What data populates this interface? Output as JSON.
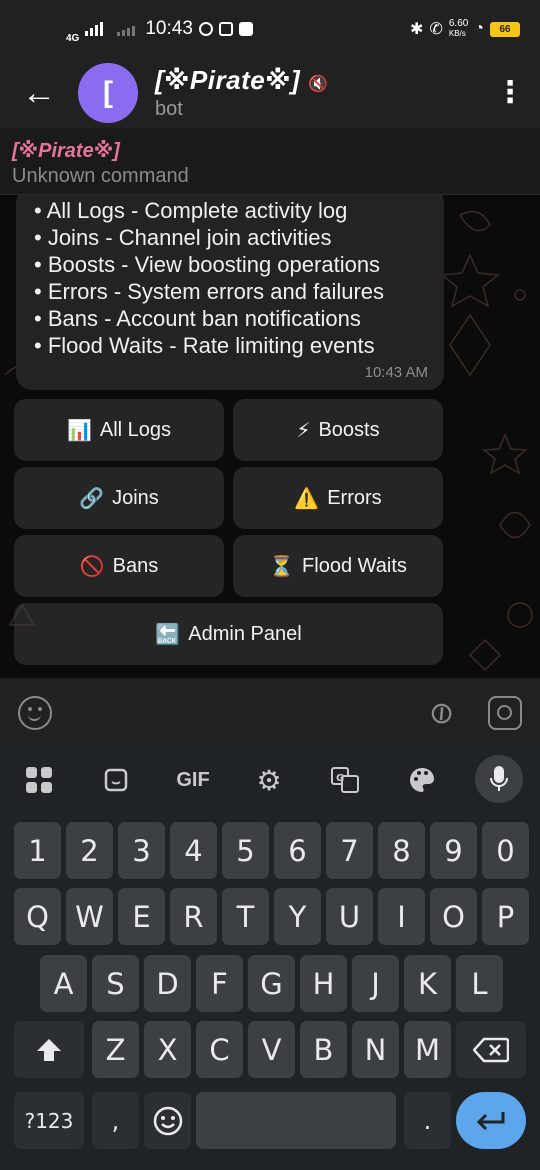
{
  "status_bar": {
    "network": "4G",
    "time": "10:43",
    "speed_value": "6.60",
    "speed_unit": "KB/s",
    "battery": "66"
  },
  "header": {
    "back_icon": "arrow-left-icon",
    "avatar_letter": "[",
    "avatar_color": "#8b6cf0",
    "title": "[※Pirate※]",
    "mute_icon": "🔇",
    "subtitle": "bot"
  },
  "pinned": {
    "sender": "[※Pirate※]",
    "message": "Unknown command",
    "sender_color": "#e8739a"
  },
  "message": {
    "lines": [
      "• All Logs - Complete activity log",
      "• Joins - Channel join activities",
      "• Boosts - View boosting operations",
      "• Errors - System errors and failures",
      "• Bans - Account ban notifications",
      "• Flood Waits - Rate limiting events"
    ],
    "time": "10:43 AM"
  },
  "inline_buttons": [
    {
      "icon": "📊",
      "label": "All Logs"
    },
    {
      "icon": "⚡",
      "label": "Boosts"
    },
    {
      "icon": "🔗",
      "label": "Joins"
    },
    {
      "icon": "⚠️",
      "label": "Errors"
    },
    {
      "icon": "🚫",
      "label": "Bans"
    },
    {
      "icon": "⏳",
      "label": "Flood Waits"
    },
    {
      "icon": "🔙",
      "label": "Admin Panel"
    }
  ],
  "keyboard": {
    "toolbar": {
      "gif": "GIF"
    },
    "row_numbers": [
      "1",
      "2",
      "3",
      "4",
      "5",
      "6",
      "7",
      "8",
      "9",
      "0"
    ],
    "row_1": [
      "Q",
      "W",
      "E",
      "R",
      "T",
      "Y",
      "U",
      "I",
      "O",
      "P"
    ],
    "row_2": [
      "A",
      "S",
      "D",
      "F",
      "G",
      "H",
      "J",
      "K",
      "L"
    ],
    "row_3": [
      "Z",
      "X",
      "C",
      "V",
      "B",
      "N",
      "M"
    ],
    "symbols_key": "?123",
    "comma": ",",
    "period": ".",
    "enter_color": "#5ea6ec"
  }
}
